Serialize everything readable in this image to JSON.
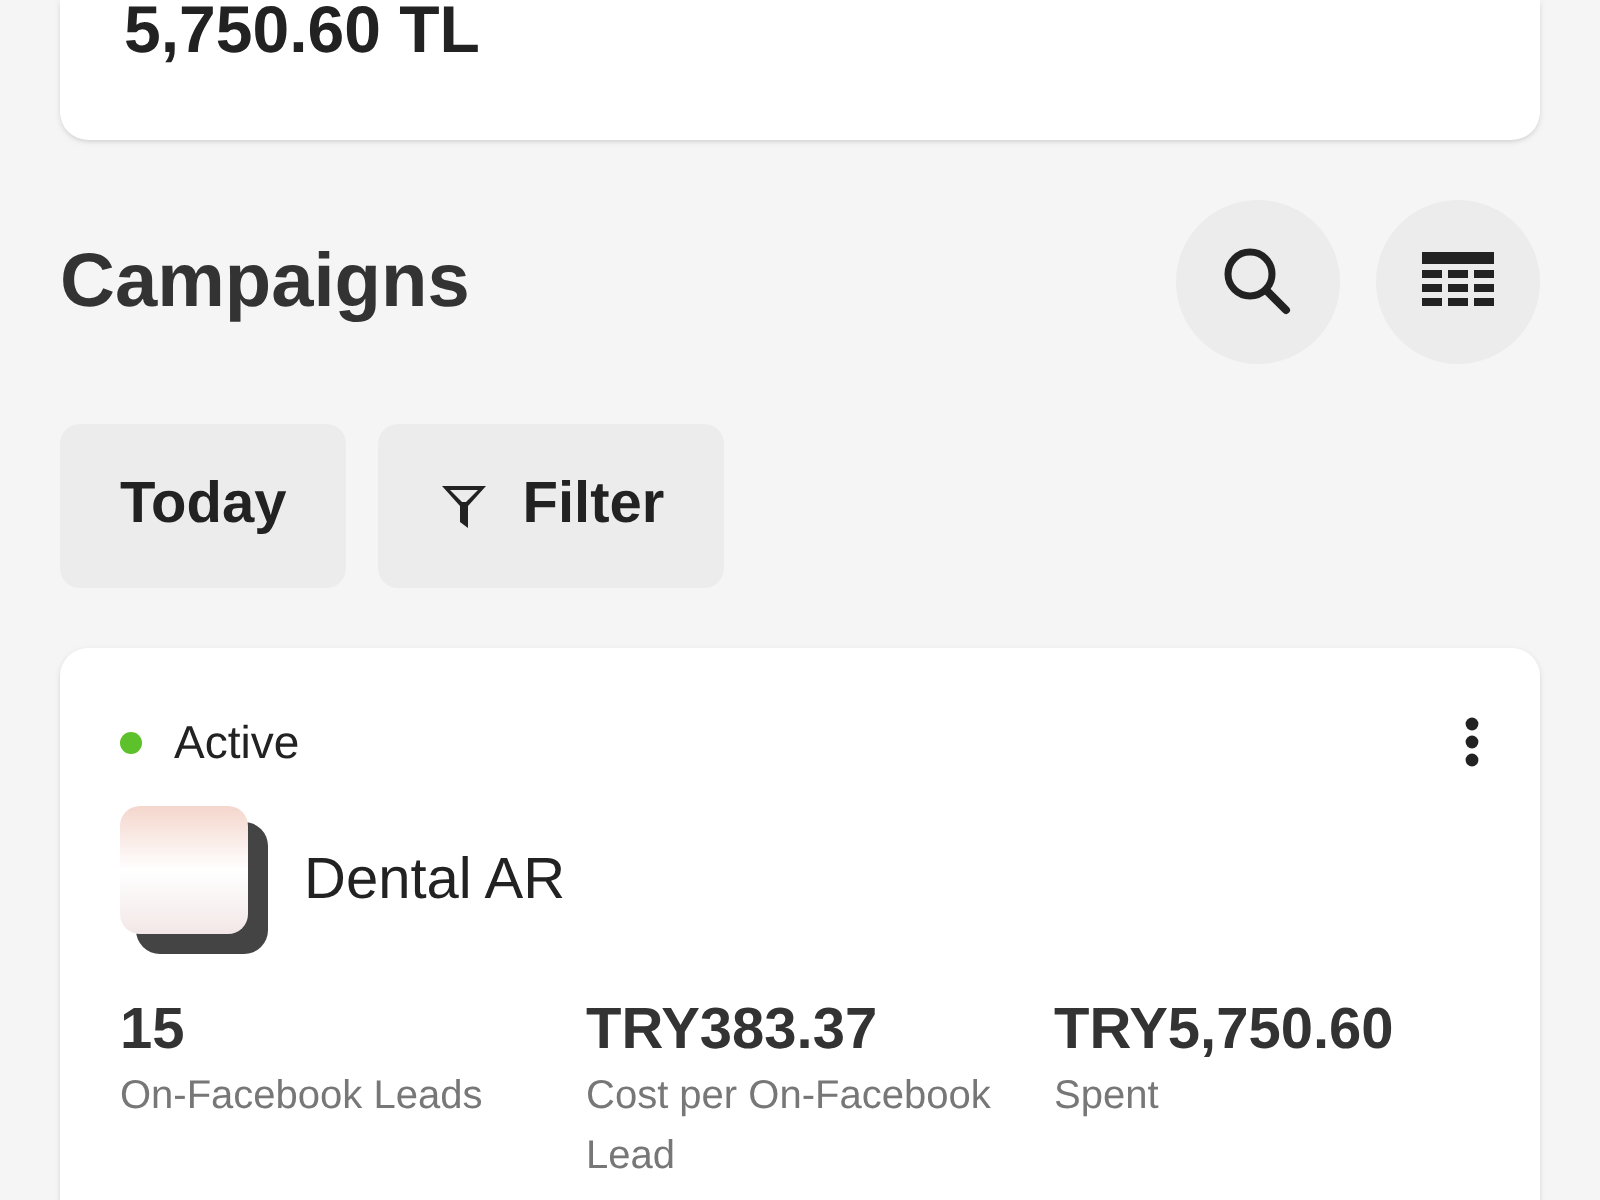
{
  "summary": {
    "amount": "5,750.60 TL"
  },
  "header": {
    "title": "Campaigns"
  },
  "chips": [
    {
      "label": "Today",
      "kind": "plain"
    },
    {
      "label": "Filter",
      "kind": "filter"
    }
  ],
  "campaigns": [
    {
      "status": "Active",
      "color": "#5cc12a",
      "name": "Dental AR",
      "metrics": [
        {
          "value": "15",
          "label": "On-Facebook Leads"
        },
        {
          "value": "TRY383.37",
          "label": "Cost per On-Facebook Lead"
        },
        {
          "value": "TRY5,750.60",
          "label": "Spent"
        }
      ]
    }
  ]
}
